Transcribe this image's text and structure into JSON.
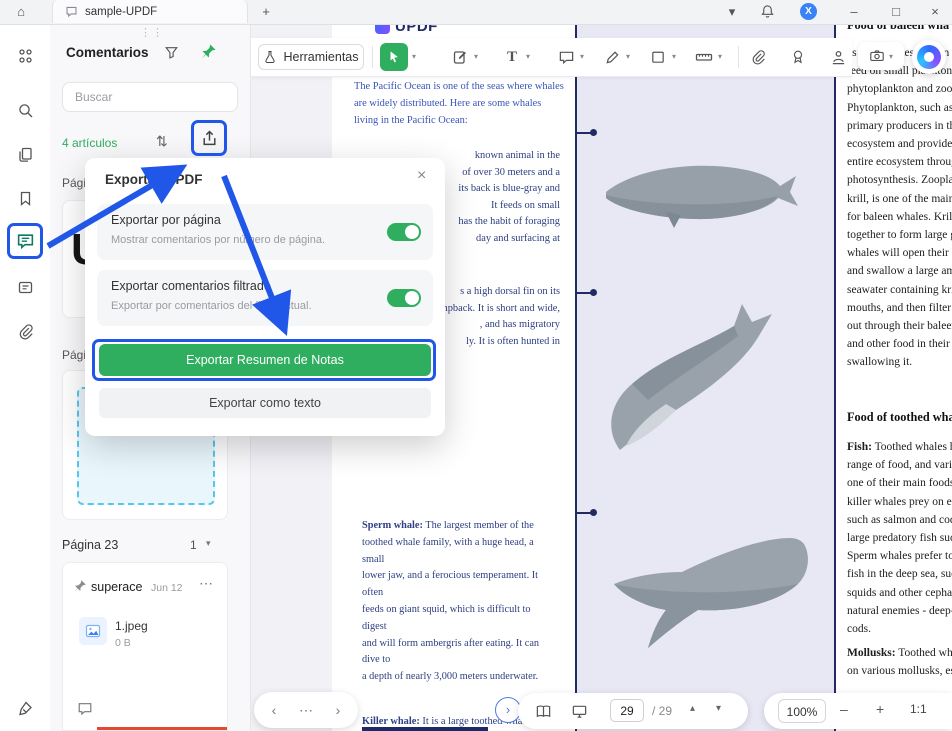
{
  "colors": {
    "accent_green": "#2fae60",
    "annotation_blue": "#2057e8",
    "navy": "#232a62",
    "avatar_blue": "#3b82f6",
    "red_line": "#e2492f"
  },
  "titlebar": {
    "tab_title": "sample-UPDF"
  },
  "icons": {
    "home": "⌂",
    "plus": "+",
    "chevron_down": "▾",
    "chevron_up": "▴",
    "minimize": "–",
    "maximize": "□",
    "close": "×",
    "avatar_initial": "X",
    "sort": "⇅",
    "more": "⋯",
    "handle": "⋮⋮",
    "prev": "‹",
    "next": "›",
    "text_tool": "T",
    "minus": "–",
    "zoom_plus": "+"
  },
  "comments_panel": {
    "title": "Comentarios",
    "search_placeholder": "Buscar",
    "count_label": "4 artículos",
    "section1_label": "Página",
    "preview_letter": "U",
    "section2_label": "Página",
    "page23_label": "Página 23",
    "page23_count": "1",
    "comment": {
      "author": "superace",
      "date": "Jun 12",
      "more": "⋯",
      "attachment_name": "1.jpeg",
      "attachment_size": "0 B"
    }
  },
  "export_dialog": {
    "title": "Exportar a PDF",
    "close": "×",
    "options": [
      {
        "label": "Exportar por página",
        "desc": "Mostrar comentarios por número de página.",
        "enabled": true
      },
      {
        "label": "Exportar comentarios filtrado",
        "desc": "Exportar por comentarios del filtro actual.",
        "enabled": true
      }
    ],
    "primary_button": "Exportar Resumen de Notas",
    "secondary_button": "Exportar como texto"
  },
  "toolbar": {
    "tools_label": "Herramientas"
  },
  "document": {
    "logo_text": "UPDF",
    "intro_lines": [
      "The Pacific Ocean is one of the seas where whales",
      "are widely distributed. Here are some whales",
      "living in the Pacific Ocean:"
    ],
    "blue_whale_fragments": [
      "known animal in the",
      "of over 30 meters and a",
      "its back is blue-gray and",
      "It feeds on small",
      "has the habit of foraging",
      "day and surfacing at"
    ],
    "humpback_fragments": [
      "s a high dorsal fin on its",
      "mpback. It is short and wide,",
      ", and has migratory",
      "ly. It is often hunted in"
    ],
    "sperm_whale": {
      "label": "Sperm whale:",
      "first_rest": " The largest member of the",
      "lines": [
        "toothed whale family, with a huge head, a small",
        "lower jaw, and a ferocious temperament. It often",
        "feeds on giant squid, which is difficult to digest",
        "and will form ambergris after eating. It can dive to",
        "a depth of nearly 3,000 meters underwater."
      ]
    },
    "killer_whale": {
      "label": "Killer whale:",
      "rest": " It is a large toothed whal"
    },
    "right_column": {
      "heading_baleen": "Food of baleen wha",
      "baleen_lines": [
        "as blue whales and fin whal",
        "feed on small plankton, incl",
        "phytoplankton and zooplank",
        "Phytoplankton, such as diato",
        "primary producers in the ma",
        "ecosystem and provide ener",
        "entire ecosystem through",
        "photosynthesis. Zooplankto",
        "krill, is one of the main foo",
        "for baleen whales. Krill usu",
        "together to form large group",
        "whales will open their huge",
        "and swallow a large amount",
        "seawater containing krill int",
        "mouths, and then filter the s",
        "out through their baleen, lea",
        "and other food in their mout",
        "swallowing it."
      ],
      "heading_toothed": "Food of toothed wha",
      "fish": {
        "label": "Fish:",
        "first_rest": " Toothed whales have a",
        "lines": [
          "range of food, and various f",
          "one of their main foods. For",
          "killer whales prey on econo",
          "such as salmon and cod, as",
          "large predatory fish such as",
          "Sperm whales prefer to prey",
          "fish in the deep sea, such as",
          "squids and other cephalopo",
          "natural enemies - deep-sea g",
          "cods."
        ]
      },
      "mollusks": {
        "label": "Mollusks:",
        "first_rest": " Toothed whales a",
        "lines": [
          "on various mollusks, especi"
        ]
      }
    }
  },
  "bottom_bar": {
    "page_current": "29",
    "page_total": "/ 29",
    "zoom": "100%",
    "fit": "1:1"
  }
}
